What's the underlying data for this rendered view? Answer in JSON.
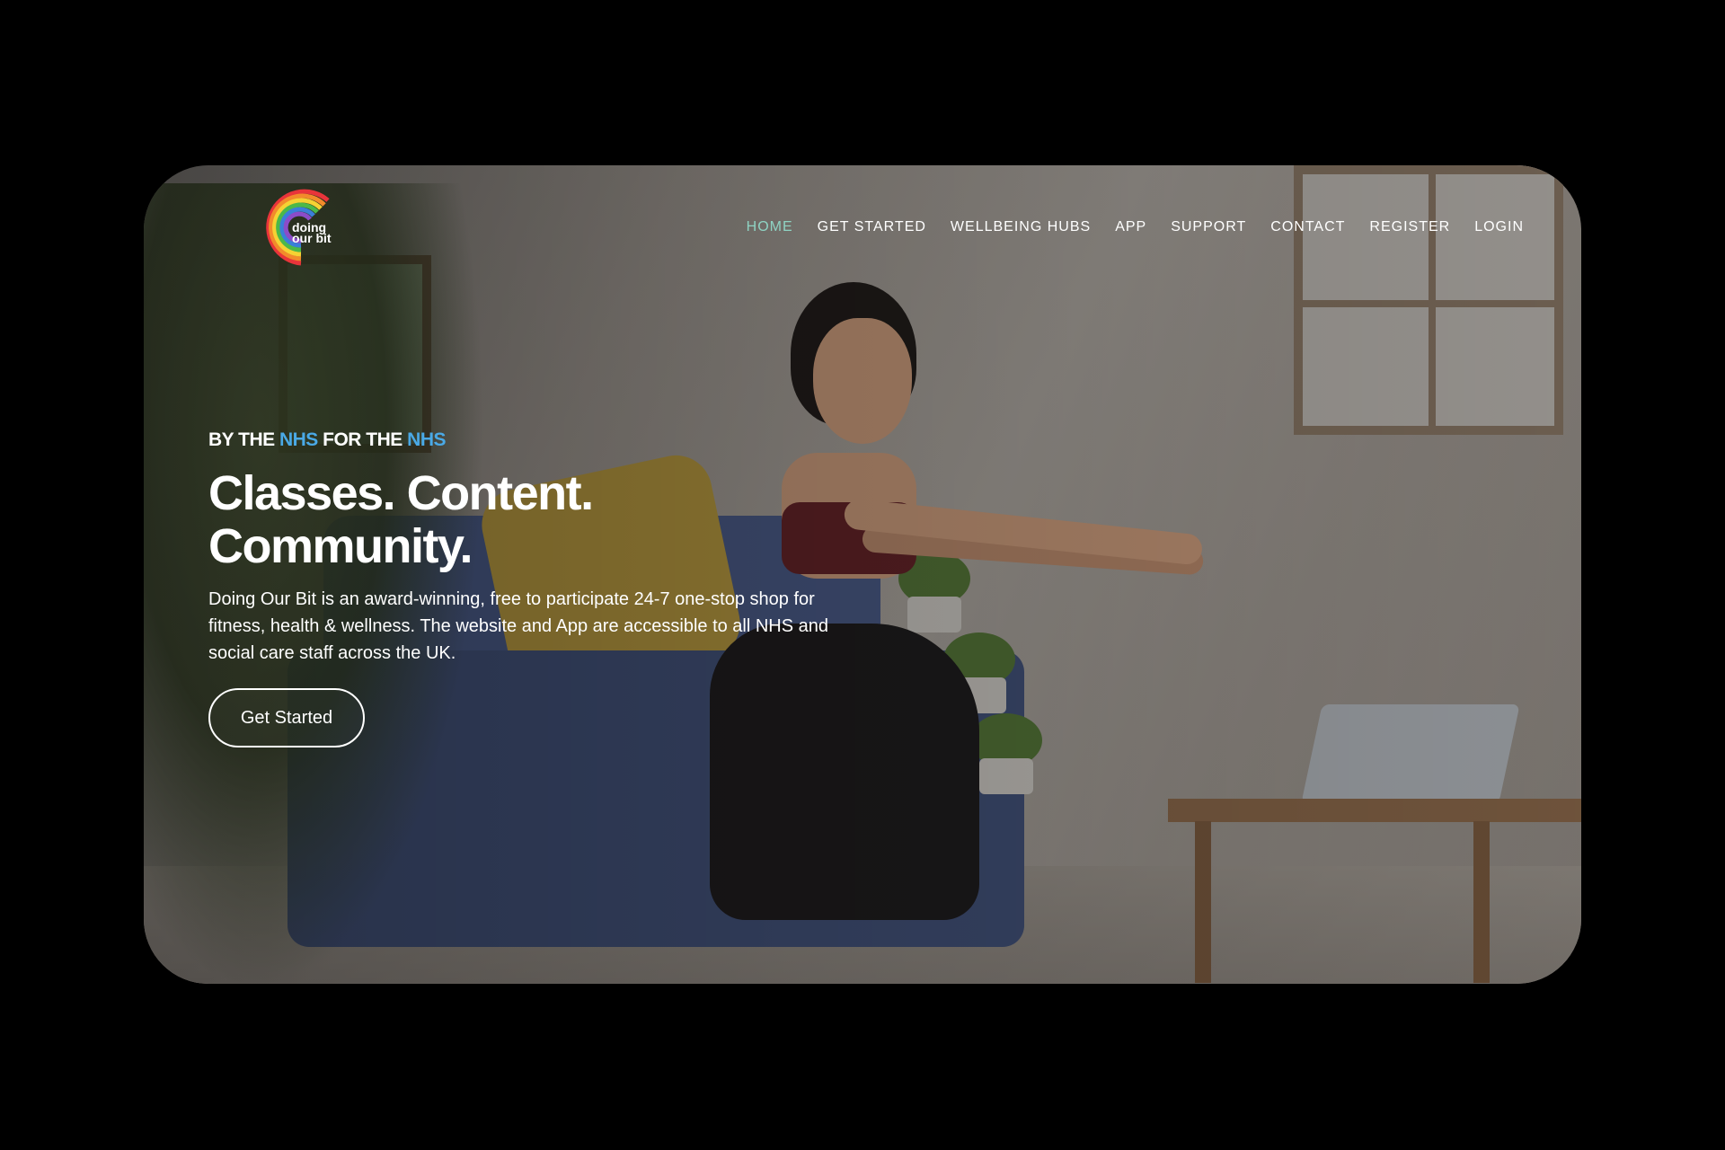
{
  "logo": {
    "text_lines": [
      "doing",
      "our bit"
    ]
  },
  "nav": {
    "items": [
      {
        "label": "HOME",
        "active": true
      },
      {
        "label": "GET STARTED",
        "active": false
      },
      {
        "label": "WELLBEING HUBS",
        "active": false
      },
      {
        "label": "APP",
        "active": false
      },
      {
        "label": "SUPPORT",
        "active": false
      },
      {
        "label": "CONTACT",
        "active": false
      },
      {
        "label": "REGISTER",
        "active": false
      },
      {
        "label": "LOGIN",
        "active": false
      }
    ],
    "active_color": "#8fd3c3"
  },
  "hero": {
    "tagline_parts": [
      "BY THE ",
      "NHS",
      " FOR THE ",
      "NHS"
    ],
    "tagline_highlight_color": "#4aa9e6",
    "headline_line1": "Classes. Content.",
    "headline_line2": "Community.",
    "description": "Doing Our Bit is an award-winning, free to participate 24-7 one-stop shop for fitness, health & wellness. The website and App are accessible to all NHS and social care staff across the UK.",
    "cta_label": "Get Started"
  }
}
